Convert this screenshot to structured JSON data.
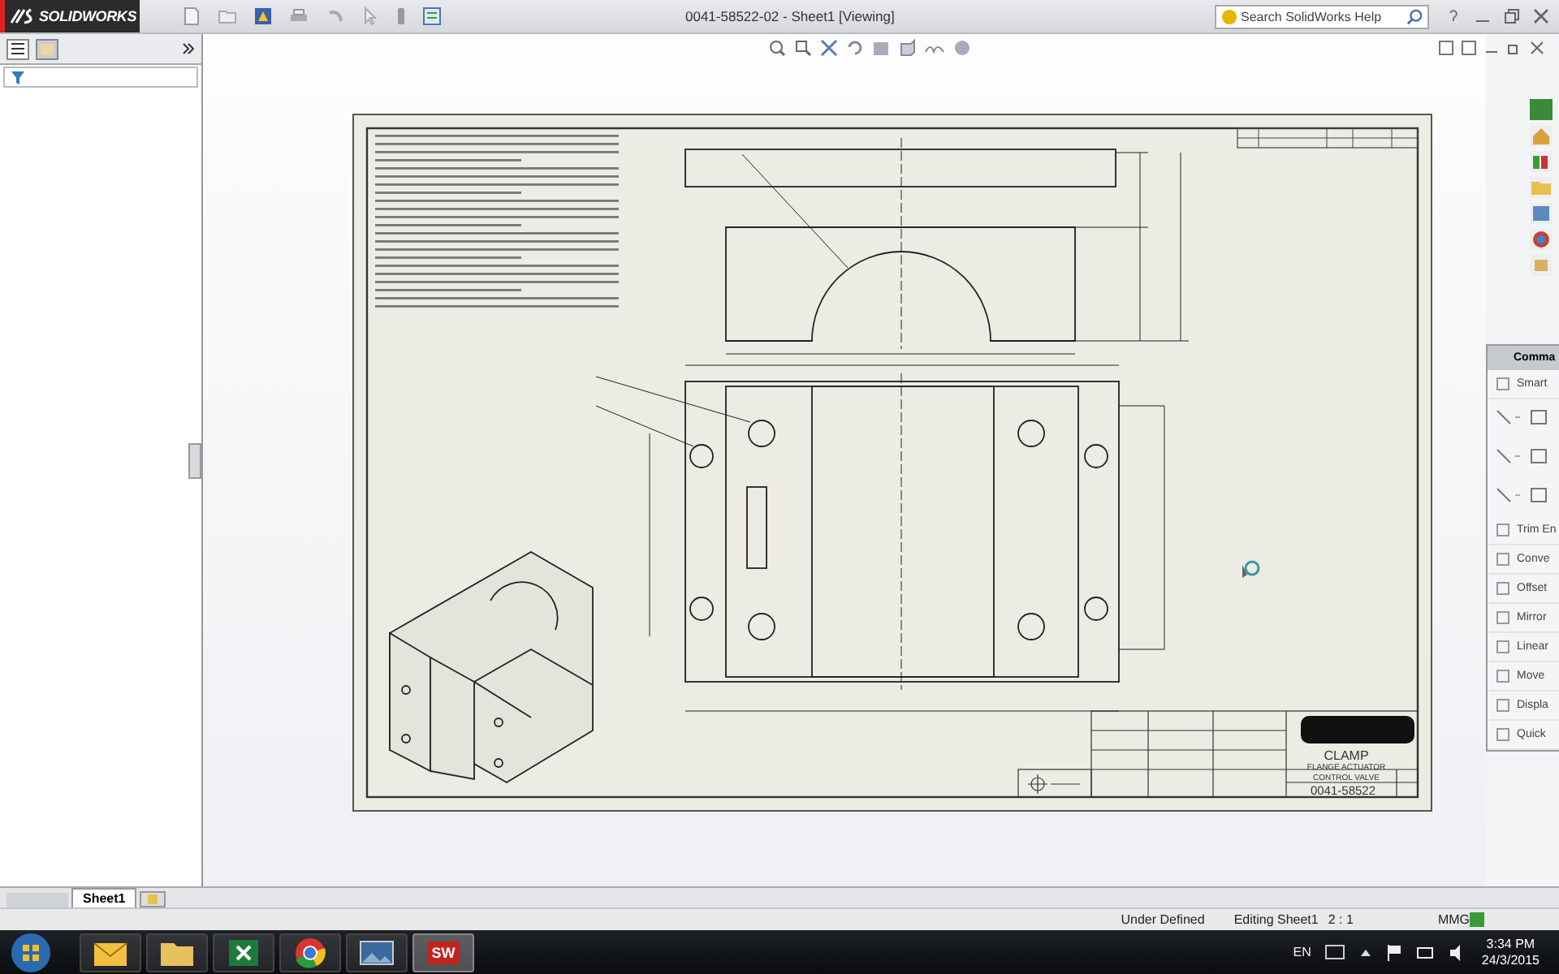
{
  "app": {
    "logo": "SOLIDWORKS"
  },
  "title": "0041-58522-02 - Sheet1 [Viewing]",
  "search": {
    "placeholder": "Search SolidWorks Help"
  },
  "command_panel": {
    "title": "Comma",
    "items": [
      {
        "kind": "tool",
        "label": "Smart"
      },
      {
        "kind": "shapes"
      },
      {
        "kind": "shapes"
      },
      {
        "kind": "shapes"
      },
      {
        "kind": "tool",
        "label": "Trim En"
      },
      {
        "kind": "tool",
        "label": "Conve"
      },
      {
        "kind": "tool",
        "label": "Offset"
      },
      {
        "kind": "tool",
        "label": "Mirror"
      },
      {
        "kind": "tool",
        "label": "Linear"
      },
      {
        "kind": "tool",
        "label": "Move"
      },
      {
        "kind": "tool",
        "label": "Displa"
      },
      {
        "kind": "tool",
        "label": "Quick"
      }
    ]
  },
  "title_block": {
    "title": "CLAMP",
    "subtitle": "FLANGE ACTUATOR",
    "subtitle_2": "CONTROL VALVE",
    "number": "0041-58522"
  },
  "sheet_tabs": [
    {
      "label": "Sheet1",
      "selected": true
    }
  ],
  "status_bar": [
    "Under Defined",
    "Editing Sheet1",
    "2 : 1",
    "MMG"
  ],
  "taskbar": {
    "apps": [
      {
        "kind": "mail",
        "selected": false
      },
      {
        "kind": "folder",
        "selected": false
      },
      {
        "kind": "sheet",
        "selected": false
      },
      {
        "kind": "browser",
        "selected": false
      },
      {
        "kind": "photo",
        "selected": false
      },
      {
        "kind": "cad",
        "label": "SW",
        "selected": true
      }
    ],
    "language": "EN",
    "time": "3:34 PM",
    "date": "24/3/2015"
  }
}
